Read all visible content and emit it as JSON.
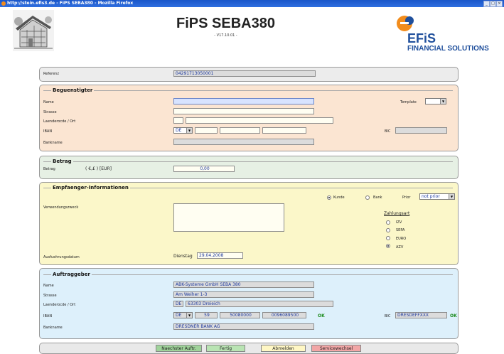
{
  "window": {
    "title": "http://stein.efis3.de - FiPS SEBA380 - Mozilla Firefox",
    "controls": [
      "_",
      "□",
      "×"
    ]
  },
  "header": {
    "app_title": "FiPS SEBA380",
    "version": "- V17.10.01 -"
  },
  "logo": {
    "name": "EFiS",
    "subtitle": "FINANCIAL SOLUTIONS",
    "brand_color": "#1f4f9c",
    "mark_color": "#f28c1c"
  },
  "referenz": {
    "label": "Referenz",
    "value": "04291713050001"
  },
  "beguenstigter": {
    "title": "Beguenstigter",
    "name_label": "Name",
    "name_value": "",
    "template_label": "Template",
    "template_value": "",
    "strasse_label": "Strasse",
    "ort_label": "Laenderocde / Ort",
    "iban_label": "IBAN",
    "iban_country": "DE",
    "bic_label": "BIC",
    "bank_label": "Bankname"
  },
  "betrag": {
    "title": "Betrag",
    "label": "Betrag",
    "currency": "( €,£ ) [EUR]",
    "value": "0,00"
  },
  "empfaenger": {
    "title": "Empfaenger-Informationen",
    "kunde_label": "Kunde",
    "bank_label": "Bank",
    "prior_label": "Prior",
    "prior_value": "not prior",
    "verwendung_label": "Verwendungszweck",
    "zahlungsart_label": "Zahlungsart",
    "zahlungsarten": [
      "IZV",
      "SEPA",
      "EURO",
      "AZV"
    ],
    "zahlungsart_selected": "AZV",
    "ausfuehrung_label": "Ausfuehrungsdatum",
    "ausfuehrung_day": "Dienstag",
    "ausfuehrung_date": "29.04.2008"
  },
  "auftraggeber": {
    "title": "Auftraggeber",
    "name_label": "Name",
    "name_value": "ABK-Systeme GmbH SEBA 380",
    "strasse_label": "Strasse",
    "strasse_value": "Am Weiher 1-3",
    "ort_label": "Laenderocde / Ort",
    "country": "DE",
    "ort_value": "63303 Dreieich",
    "iban_label": "IBAN",
    "iban_country": "DE",
    "iban_check": "59",
    "iban_blz": "50080000",
    "iban_konto": "0096089500",
    "iban_status": "OK",
    "bic_label": "BIC",
    "bic_value": "DRESDEFFXXX",
    "bic_status": "OK",
    "bank_label": "Bankname",
    "bank_value": "DRESDNER BANK AG"
  },
  "buttons": {
    "next": "Naechster Auftr.",
    "done": "Fertig",
    "logout": "Abmelden",
    "service": "Servicewechsel"
  }
}
